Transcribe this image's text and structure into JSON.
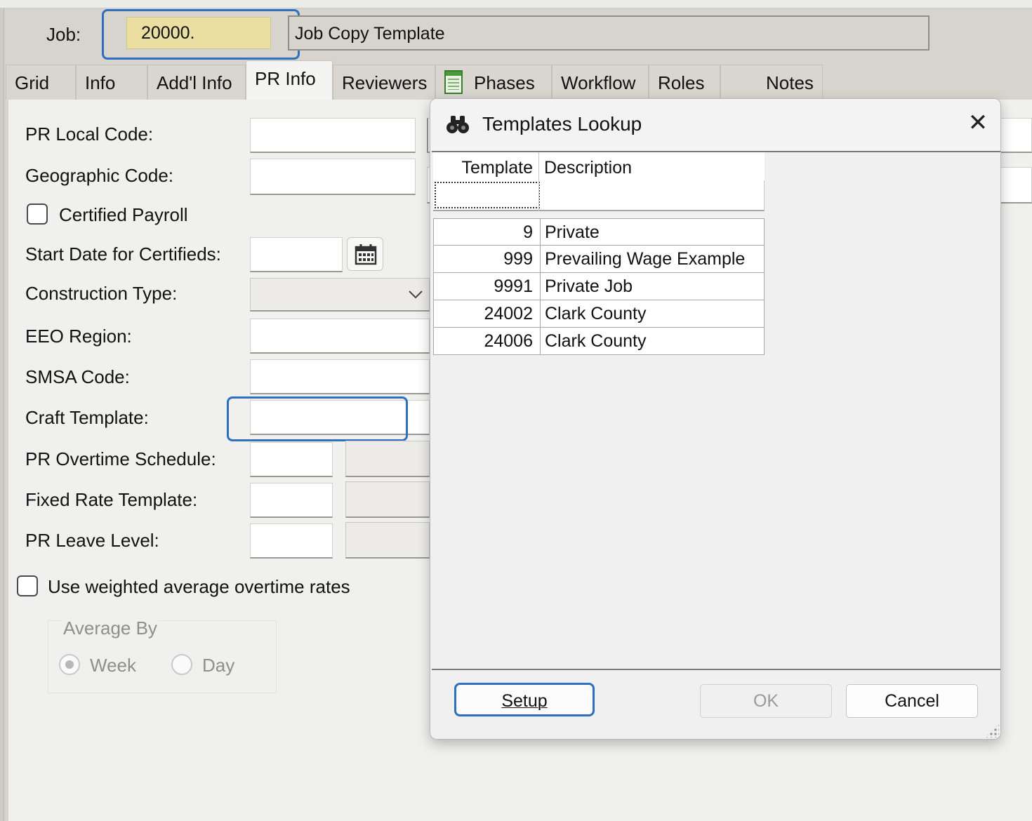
{
  "header": {
    "job_label": "Job:",
    "job_number": "20000.",
    "job_description": "Job Copy Template"
  },
  "tabs": [
    {
      "label": "Grid"
    },
    {
      "label": "Info"
    },
    {
      "label": "Add'l Info"
    },
    {
      "label": "PR Info",
      "active": true
    },
    {
      "label": "Reviewers"
    },
    {
      "label": "Phases",
      "icon": "phases-icon"
    },
    {
      "label": "Workflow"
    },
    {
      "label": "Roles"
    },
    {
      "label": "Notes"
    }
  ],
  "form": {
    "pr_local_code": {
      "label": "PR Local Code:",
      "value": ""
    },
    "geographic_code": {
      "label": "Geographic Code:",
      "value": ""
    },
    "certified_payroll": {
      "label": "Certified Payroll",
      "checked": false
    },
    "start_date_certifieds": {
      "label": "Start Date for Certifieds:",
      "value": ""
    },
    "construction_type": {
      "label": "Construction Type:",
      "value": ""
    },
    "eeo_region": {
      "label": "EEO Region:",
      "value": ""
    },
    "smsa_code": {
      "label": "SMSA Code:",
      "value": ""
    },
    "craft_template": {
      "label": "Craft Template:",
      "value": ""
    },
    "pr_overtime_schedule": {
      "label": "PR Overtime Schedule:",
      "value": ""
    },
    "fixed_rate_template": {
      "label": "Fixed Rate Template:",
      "value": ""
    },
    "pr_leave_level": {
      "label": "PR Leave Level:",
      "value": ""
    },
    "weighted_average": {
      "label": "Use weighted average overtime rates",
      "checked": false
    },
    "average_by": {
      "label": "Average By",
      "options": [
        "Week",
        "Day"
      ],
      "selected": "Week",
      "enabled": false
    }
  },
  "dialog": {
    "title": "Templates Lookup",
    "columns": [
      "Template",
      "Description"
    ],
    "filter": {
      "template": "",
      "description": ""
    },
    "rows": [
      {
        "template": "9",
        "description": "Private"
      },
      {
        "template": "999",
        "description": "Prevailing Wage Example"
      },
      {
        "template": "9991",
        "description": "Private Job"
      },
      {
        "template": "24002",
        "description": "Clark County"
      },
      {
        "template": "24006",
        "description": "Clark County"
      }
    ],
    "buttons": {
      "setup": "Setup",
      "ok": "OK",
      "cancel": "Cancel"
    },
    "ok_enabled": false
  },
  "colors": {
    "highlight": "#2e70c0",
    "job_field_bg": "#eadfa1",
    "window_bg": "#d6d4cc"
  }
}
